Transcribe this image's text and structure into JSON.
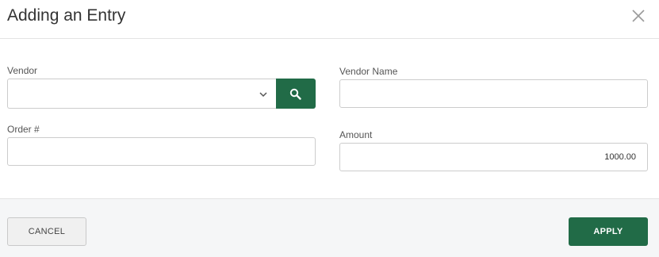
{
  "dialog": {
    "title": "Adding an Entry",
    "close_icon": "close-icon"
  },
  "form": {
    "vendor": {
      "label": "Vendor",
      "value": "",
      "dropdown_icon": "chevron-down-icon",
      "search_icon": "search-icon"
    },
    "vendor_name": {
      "label": "Vendor Name",
      "value": ""
    },
    "order_number": {
      "label": "Order #",
      "value": ""
    },
    "amount": {
      "label": "Amount",
      "value": "1000.00"
    }
  },
  "footer": {
    "cancel_label": "CANCEL",
    "apply_label": "APPLY"
  },
  "colors": {
    "accent": "#216b47",
    "footer_bg": "#f5f6f7",
    "border": "#cccccc"
  }
}
